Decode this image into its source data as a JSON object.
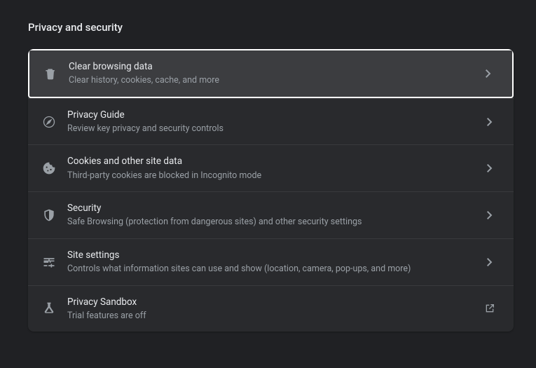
{
  "section": {
    "title": "Privacy and security"
  },
  "rows": {
    "clear_data": {
      "title": "Clear browsing data",
      "sub": "Clear history, cookies, cache, and more"
    },
    "privacy_guide": {
      "title": "Privacy Guide",
      "sub": "Review key privacy and security controls"
    },
    "cookies": {
      "title": "Cookies and other site data",
      "sub": "Third-party cookies are blocked in Incognito mode"
    },
    "security": {
      "title": "Security",
      "sub": "Safe Browsing (protection from dangerous sites) and other security settings"
    },
    "site_settings": {
      "title": "Site settings",
      "sub": "Controls what information sites can use and show (location, camera, pop-ups, and more)"
    },
    "sandbox": {
      "title": "Privacy Sandbox",
      "sub": "Trial features are off"
    }
  }
}
